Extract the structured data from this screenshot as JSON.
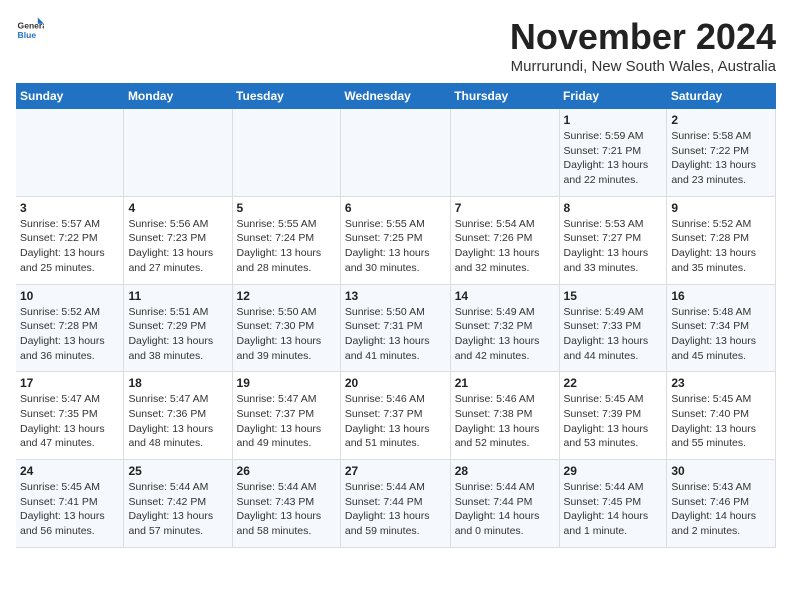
{
  "logo": {
    "text_general": "General",
    "text_blue": "Blue"
  },
  "title": "November 2024",
  "location": "Murrurundi, New South Wales, Australia",
  "days_header": [
    "Sunday",
    "Monday",
    "Tuesday",
    "Wednesday",
    "Thursday",
    "Friday",
    "Saturday"
  ],
  "weeks": [
    [
      {
        "day": "",
        "info": ""
      },
      {
        "day": "",
        "info": ""
      },
      {
        "day": "",
        "info": ""
      },
      {
        "day": "",
        "info": ""
      },
      {
        "day": "",
        "info": ""
      },
      {
        "day": "1",
        "info": "Sunrise: 5:59 AM\nSunset: 7:21 PM\nDaylight: 13 hours and 22 minutes."
      },
      {
        "day": "2",
        "info": "Sunrise: 5:58 AM\nSunset: 7:22 PM\nDaylight: 13 hours and 23 minutes."
      }
    ],
    [
      {
        "day": "3",
        "info": "Sunrise: 5:57 AM\nSunset: 7:22 PM\nDaylight: 13 hours and 25 minutes."
      },
      {
        "day": "4",
        "info": "Sunrise: 5:56 AM\nSunset: 7:23 PM\nDaylight: 13 hours and 27 minutes."
      },
      {
        "day": "5",
        "info": "Sunrise: 5:55 AM\nSunset: 7:24 PM\nDaylight: 13 hours and 28 minutes."
      },
      {
        "day": "6",
        "info": "Sunrise: 5:55 AM\nSunset: 7:25 PM\nDaylight: 13 hours and 30 minutes."
      },
      {
        "day": "7",
        "info": "Sunrise: 5:54 AM\nSunset: 7:26 PM\nDaylight: 13 hours and 32 minutes."
      },
      {
        "day": "8",
        "info": "Sunrise: 5:53 AM\nSunset: 7:27 PM\nDaylight: 13 hours and 33 minutes."
      },
      {
        "day": "9",
        "info": "Sunrise: 5:52 AM\nSunset: 7:28 PM\nDaylight: 13 hours and 35 minutes."
      }
    ],
    [
      {
        "day": "10",
        "info": "Sunrise: 5:52 AM\nSunset: 7:28 PM\nDaylight: 13 hours and 36 minutes."
      },
      {
        "day": "11",
        "info": "Sunrise: 5:51 AM\nSunset: 7:29 PM\nDaylight: 13 hours and 38 minutes."
      },
      {
        "day": "12",
        "info": "Sunrise: 5:50 AM\nSunset: 7:30 PM\nDaylight: 13 hours and 39 minutes."
      },
      {
        "day": "13",
        "info": "Sunrise: 5:50 AM\nSunset: 7:31 PM\nDaylight: 13 hours and 41 minutes."
      },
      {
        "day": "14",
        "info": "Sunrise: 5:49 AM\nSunset: 7:32 PM\nDaylight: 13 hours and 42 minutes."
      },
      {
        "day": "15",
        "info": "Sunrise: 5:49 AM\nSunset: 7:33 PM\nDaylight: 13 hours and 44 minutes."
      },
      {
        "day": "16",
        "info": "Sunrise: 5:48 AM\nSunset: 7:34 PM\nDaylight: 13 hours and 45 minutes."
      }
    ],
    [
      {
        "day": "17",
        "info": "Sunrise: 5:47 AM\nSunset: 7:35 PM\nDaylight: 13 hours and 47 minutes."
      },
      {
        "day": "18",
        "info": "Sunrise: 5:47 AM\nSunset: 7:36 PM\nDaylight: 13 hours and 48 minutes."
      },
      {
        "day": "19",
        "info": "Sunrise: 5:47 AM\nSunset: 7:37 PM\nDaylight: 13 hours and 49 minutes."
      },
      {
        "day": "20",
        "info": "Sunrise: 5:46 AM\nSunset: 7:37 PM\nDaylight: 13 hours and 51 minutes."
      },
      {
        "day": "21",
        "info": "Sunrise: 5:46 AM\nSunset: 7:38 PM\nDaylight: 13 hours and 52 minutes."
      },
      {
        "day": "22",
        "info": "Sunrise: 5:45 AM\nSunset: 7:39 PM\nDaylight: 13 hours and 53 minutes."
      },
      {
        "day": "23",
        "info": "Sunrise: 5:45 AM\nSunset: 7:40 PM\nDaylight: 13 hours and 55 minutes."
      }
    ],
    [
      {
        "day": "24",
        "info": "Sunrise: 5:45 AM\nSunset: 7:41 PM\nDaylight: 13 hours and 56 minutes."
      },
      {
        "day": "25",
        "info": "Sunrise: 5:44 AM\nSunset: 7:42 PM\nDaylight: 13 hours and 57 minutes."
      },
      {
        "day": "26",
        "info": "Sunrise: 5:44 AM\nSunset: 7:43 PM\nDaylight: 13 hours and 58 minutes."
      },
      {
        "day": "27",
        "info": "Sunrise: 5:44 AM\nSunset: 7:44 PM\nDaylight: 13 hours and 59 minutes."
      },
      {
        "day": "28",
        "info": "Sunrise: 5:44 AM\nSunset: 7:44 PM\nDaylight: 14 hours and 0 minutes."
      },
      {
        "day": "29",
        "info": "Sunrise: 5:44 AM\nSunset: 7:45 PM\nDaylight: 14 hours and 1 minute."
      },
      {
        "day": "30",
        "info": "Sunrise: 5:43 AM\nSunset: 7:46 PM\nDaylight: 14 hours and 2 minutes."
      }
    ]
  ]
}
